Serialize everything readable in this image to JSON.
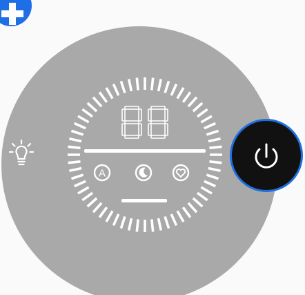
{
  "display": {
    "digits": "88"
  },
  "modes": [
    {
      "name": "auto",
      "glyph": "A"
    },
    {
      "name": "sleep",
      "glyph": "moon-icon"
    },
    {
      "name": "favorite",
      "glyph": "heart-icon"
    }
  ],
  "icons": {
    "corner": "plus-icon",
    "light": "light-bulb-icon",
    "power": "power-icon"
  },
  "colors": {
    "panel": "#a9a9a9",
    "accent": "#1f6fe0",
    "power_bg": "#111111",
    "segment": "#ffffff"
  }
}
